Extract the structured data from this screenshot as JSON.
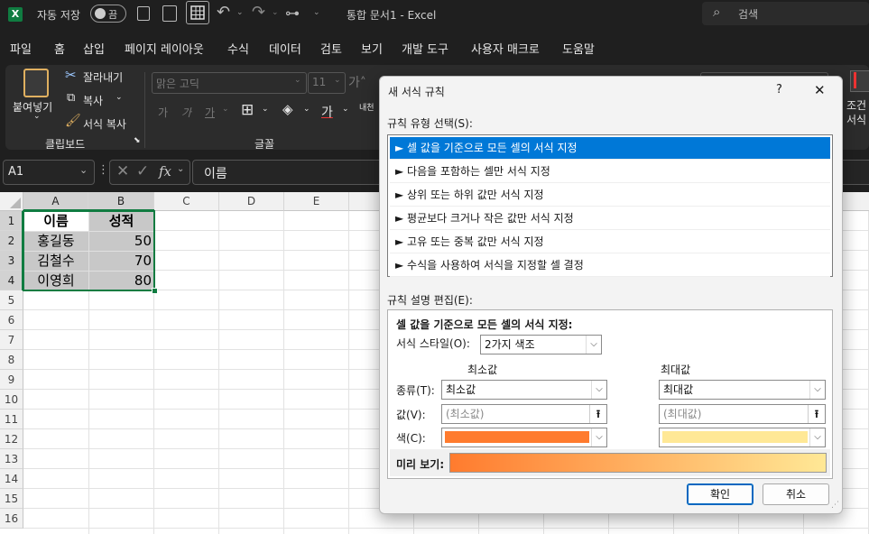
{
  "titlebar": {
    "autosave_label": "자동 저장",
    "autosave_state": "끔",
    "doc_title": "통합 문서1 - Excel",
    "search_placeholder": "검색",
    "accent_color": "#107c41"
  },
  "menu": {
    "items": [
      "파일",
      "홈",
      "삽입",
      "페이지 레이아웃",
      "수식",
      "데이터",
      "검토",
      "보기",
      "개발 도구",
      "사용자 매크로",
      "도움말"
    ],
    "active": "홈"
  },
  "ribbon": {
    "paste_label": "붙여넣기",
    "cut_label": "잘라내기",
    "copy_label": "복사",
    "format_painter_label": "서식 복사",
    "clipboard_group": "클립보드",
    "font_name": "맑은 고딕",
    "font_size": "11",
    "font_group": "글꼴",
    "conditional_label_1": "조건",
    "conditional_label_2": "서식"
  },
  "formula_bar": {
    "name_box": "A1",
    "fx": "fx",
    "content": "이름"
  },
  "sheet": {
    "columns": [
      "A",
      "B",
      "C",
      "D",
      "E"
    ],
    "rows": [
      "1",
      "2",
      "3",
      "4",
      "5",
      "6",
      "7",
      "8",
      "9",
      "10",
      "11",
      "12",
      "13",
      "14",
      "15",
      "16"
    ],
    "header_row": [
      "이름",
      "성적"
    ],
    "data": [
      {
        "name": "홍길동",
        "score": "50"
      },
      {
        "name": "김철수",
        "score": "70"
      },
      {
        "name": "이영희",
        "score": "80"
      }
    ]
  },
  "dialog": {
    "title": "새 서식 규칙",
    "help": "?",
    "close": "✕",
    "rule_type_label": "규칙 유형 선택(S):",
    "rule_types": [
      "► 셀 값을 기준으로 모든 셀의 서식 지정",
      "► 다음을 포함하는 셀만 서식 지정",
      "► 상위 또는 하위 값만 서식 지정",
      "► 평균보다 크거나 작은 값만 서식 지정",
      "► 고유 또는 중복 값만 서식 지정",
      "► 수식을 사용하여 서식을 지정할 셀 결정"
    ],
    "edit_label": "규칙 설명 편집(E):",
    "desc_heading": "셀 값을 기준으로 모든 셀의 서식 지정:",
    "format_style_label": "서식 스타일(O):",
    "format_style_value": "2가지 색조",
    "min_heading": "최소값",
    "max_heading": "최대값",
    "type_label": "종류(T):",
    "min_type": "최소값",
    "max_type": "최대값",
    "value_label": "값(V):",
    "min_value_placeholder": "(최소값)",
    "max_value_placeholder": "(최대값)",
    "color_label": "색(C):",
    "min_color": "#ff7b2e",
    "max_color": "#ffe896",
    "preview_label": "미리 보기:",
    "ok": "확인",
    "cancel": "취소"
  }
}
